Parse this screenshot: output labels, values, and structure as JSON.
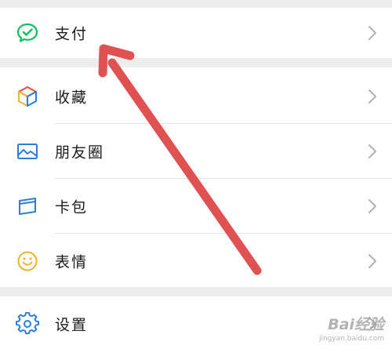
{
  "menu": {
    "payment": {
      "label": "支付",
      "icon": "wechat-pay-check-icon",
      "color": "#07c160"
    },
    "favorites": {
      "label": "收藏",
      "icon": "cube-favorites-icon"
    },
    "moments": {
      "label": "朋友圈",
      "icon": "picture-icon",
      "color": "#2a7ed8"
    },
    "cards": {
      "label": "卡包",
      "icon": "card-wallet-icon",
      "color": "#2a7ed8"
    },
    "stickers": {
      "label": "表情",
      "icon": "smiley-face-icon",
      "color": "#f0b429"
    },
    "settings": {
      "label": "设置",
      "icon": "gear-icon",
      "color": "#2a7ed8"
    }
  },
  "annotation": {
    "arrow_color": "#e05252"
  },
  "watermark": {
    "brand": "Bai经验",
    "site": "jingyan.baidu.com"
  }
}
